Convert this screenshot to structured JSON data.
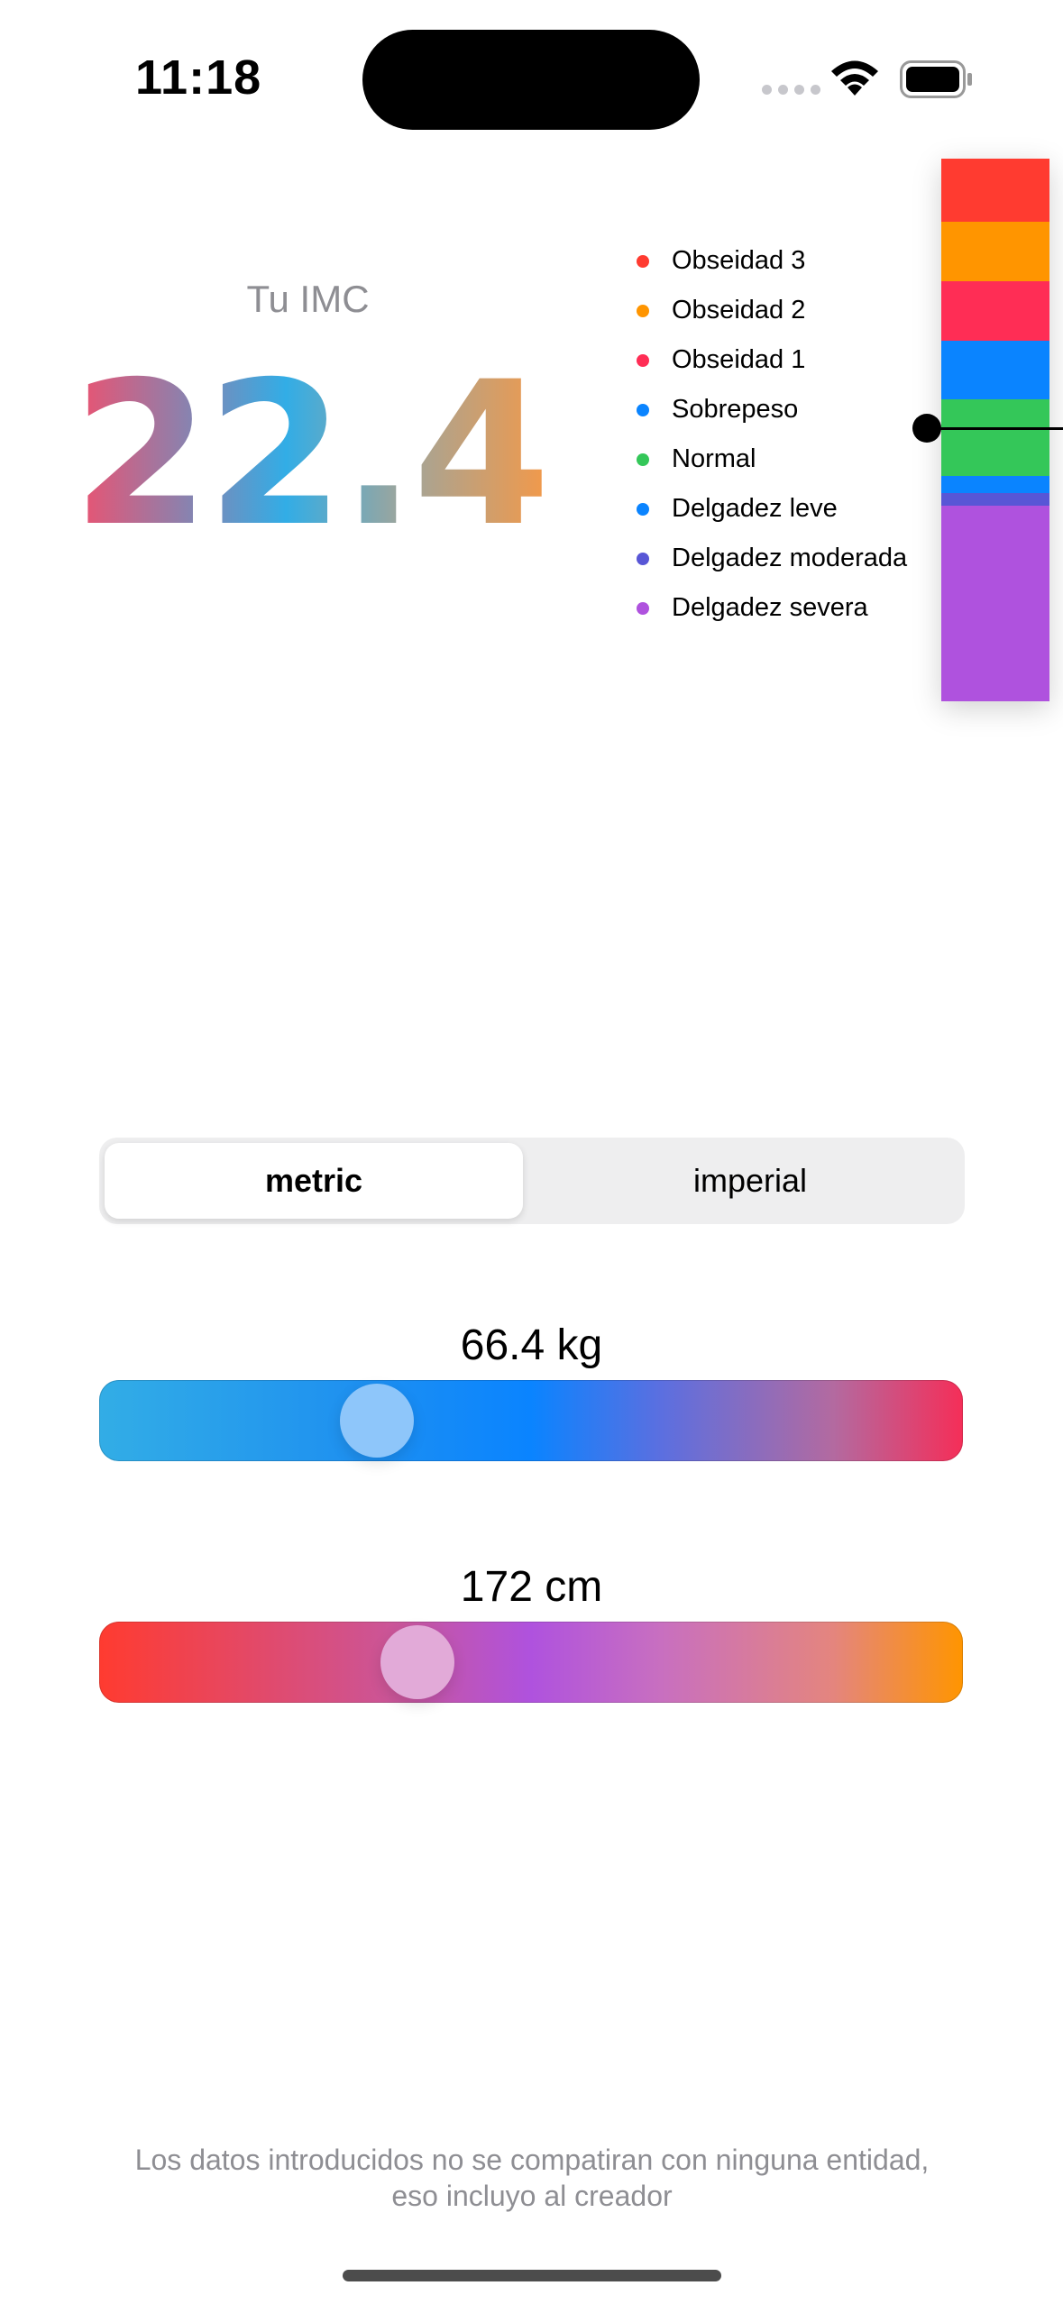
{
  "status_bar": {
    "time": "11:18",
    "icons": [
      "cellular-signal-icon",
      "wifi-icon",
      "battery-icon"
    ]
  },
  "bmi": {
    "title": "Tu IMC",
    "value": "22.4",
    "gradient_colors": [
      "#f0506e",
      "#32ade6",
      "#a1a59a",
      "#f2994a"
    ]
  },
  "legend": [
    {
      "label": "Obseidad 3",
      "color": "#ff3b30"
    },
    {
      "label": "Obseidad 2",
      "color": "#ff9500"
    },
    {
      "label": "Obseidad 1",
      "color": "#ff2d55"
    },
    {
      "label": "Sobrepeso",
      "color": "#0a84ff"
    },
    {
      "label": "Normal",
      "color": "#34c759"
    },
    {
      "label": "Delgadez leve",
      "color": "#0a84ff"
    },
    {
      "label": "Delgadez moderada",
      "color": "#5856d6"
    },
    {
      "label": "Delgadez severa",
      "color": "#af52de"
    }
  ],
  "scale": {
    "segments": [
      {
        "color": "#ff3b30",
        "fraction": 0.117
      },
      {
        "color": "#ff9500",
        "fraction": 0.109
      },
      {
        "color": "#ff2d55",
        "fraction": 0.109
      },
      {
        "color": "#0a84ff",
        "fraction": 0.109
      },
      {
        "color": "#34c759",
        "fraction": 0.141
      },
      {
        "color": "#0a84ff",
        "fraction": 0.032
      },
      {
        "color": "#5856d6",
        "fraction": 0.022
      },
      {
        "color": "#af52de",
        "fraction": 0.361
      }
    ]
  },
  "unit_toggle": {
    "options": [
      "metric",
      "imperial"
    ],
    "selected": "metric"
  },
  "weight": {
    "label": "66.4 kg",
    "slider_fraction": 0.32
  },
  "height": {
    "label": "172 cm",
    "slider_fraction": 0.37
  },
  "footer": {
    "disclaimer": "Los datos introducidos no se compatiran con ninguna entidad, eso incluyo al creador"
  }
}
